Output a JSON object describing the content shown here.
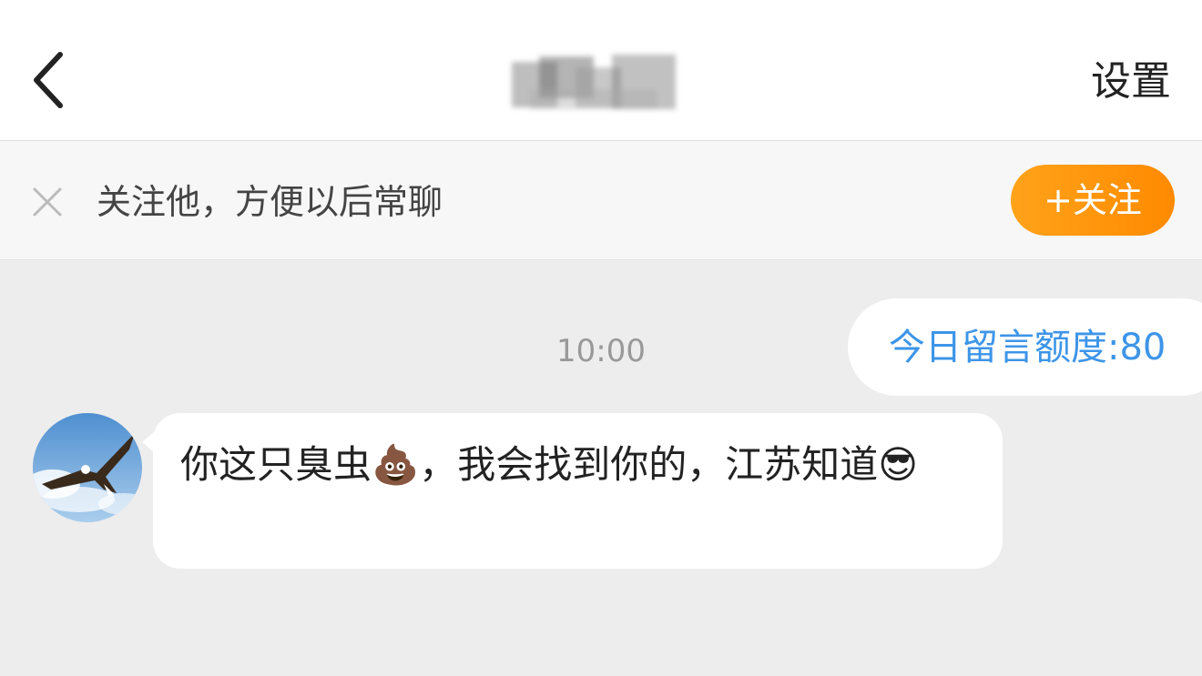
{
  "header": {
    "back_icon": "chevron-left-icon",
    "settings_label": "设置"
  },
  "follow_prompt": {
    "close_icon": "close-icon",
    "text": "关注他，方便以后常聊",
    "button_label": "+关注"
  },
  "chat": {
    "quota_text": "今日留言额度:80",
    "timestamp": "10:00",
    "message": "你这只臭虫💩，我会找到你的，江苏知道😎"
  },
  "colors": {
    "accent_orange": "#ff8a00",
    "quota_blue": "#3d95e8",
    "background": "#ededed"
  }
}
